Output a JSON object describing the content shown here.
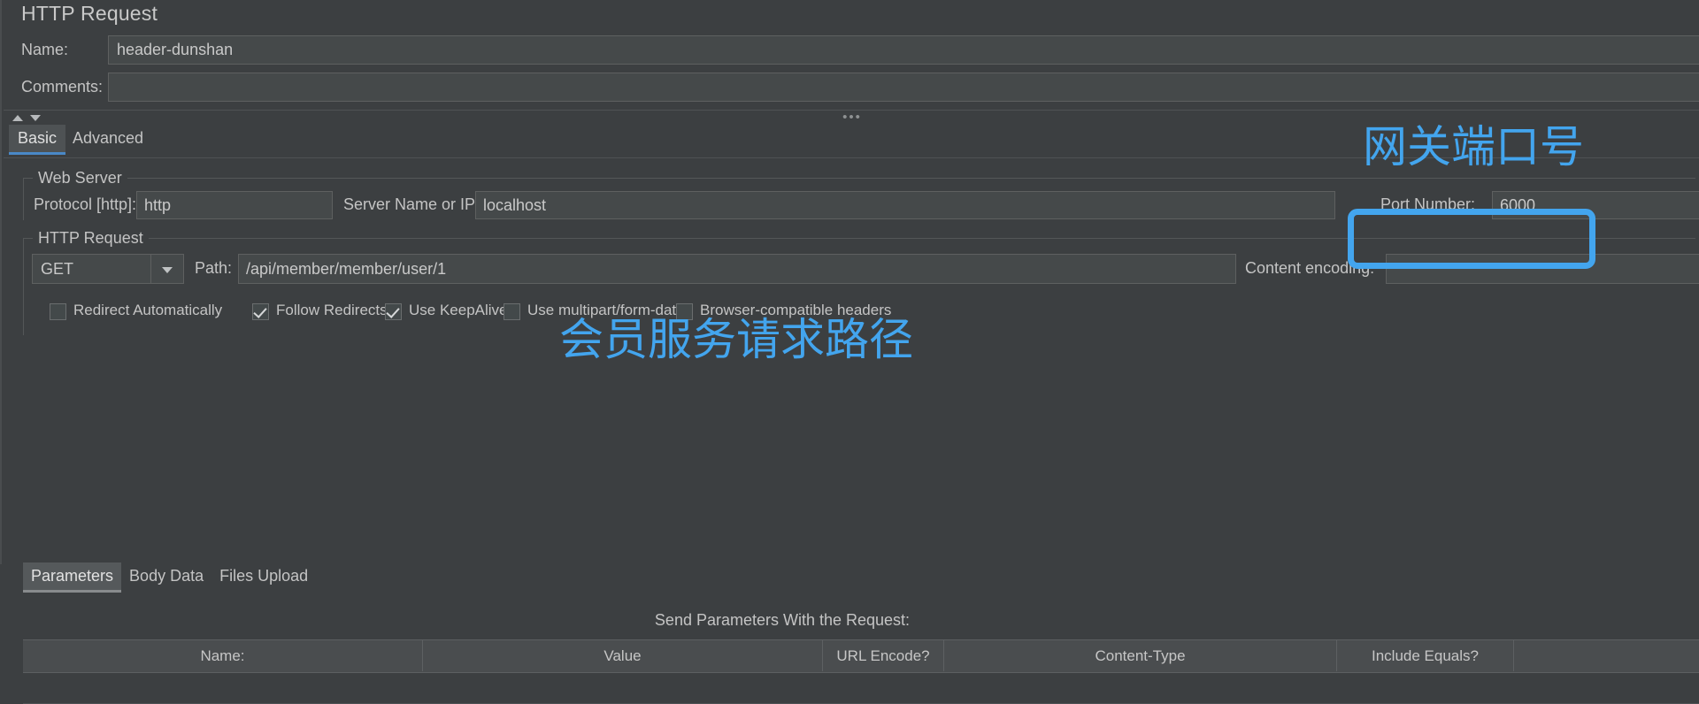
{
  "header": {
    "title": "HTTP Request",
    "name_label": "Name:",
    "name_value": "header-dunshan",
    "comments_label": "Comments:",
    "comments_value": "",
    "splitter_dots": "•••"
  },
  "tabs": [
    {
      "label": "Basic",
      "selected": true
    },
    {
      "label": "Advanced",
      "selected": false
    }
  ],
  "web_server": {
    "group_title": "Web Server",
    "protocol_label": "Protocol [http]:",
    "protocol_value": "http",
    "server_label": "Server Name or IP:",
    "server_value": "localhost",
    "port_label": "Port Number:",
    "port_value": "6000"
  },
  "http_request": {
    "group_title": "HTTP Request",
    "method_value": "GET",
    "path_label": "Path:",
    "path_value": "/api/member/member/user/1",
    "content_encoding_label": "Content encoding:",
    "content_encoding_value": "",
    "checkboxes": [
      {
        "label": "Redirect Automatically",
        "checked": false
      },
      {
        "label": "Follow Redirects",
        "checked": true
      },
      {
        "label": "Use KeepAlive",
        "checked": true
      },
      {
        "label": "Use multipart/form-data",
        "checked": false
      },
      {
        "label": "Browser-compatible headers",
        "checked": false
      }
    ]
  },
  "sub_tabs": [
    {
      "label": "Parameters",
      "selected": true
    },
    {
      "label": "Body Data",
      "selected": false
    },
    {
      "label": "Files Upload",
      "selected": false
    }
  ],
  "parameters": {
    "send_params_caption": "Send Parameters With the Request:",
    "columns": [
      "Name:",
      "Value",
      "URL Encode?",
      "Content-Type",
      "Include Equals?"
    ],
    "rows": []
  },
  "annotations": [
    {
      "text": "网关端口号",
      "color": "#43a5ee"
    },
    {
      "text": "会员服务请求路径",
      "color": "#43a5ee"
    }
  ]
}
